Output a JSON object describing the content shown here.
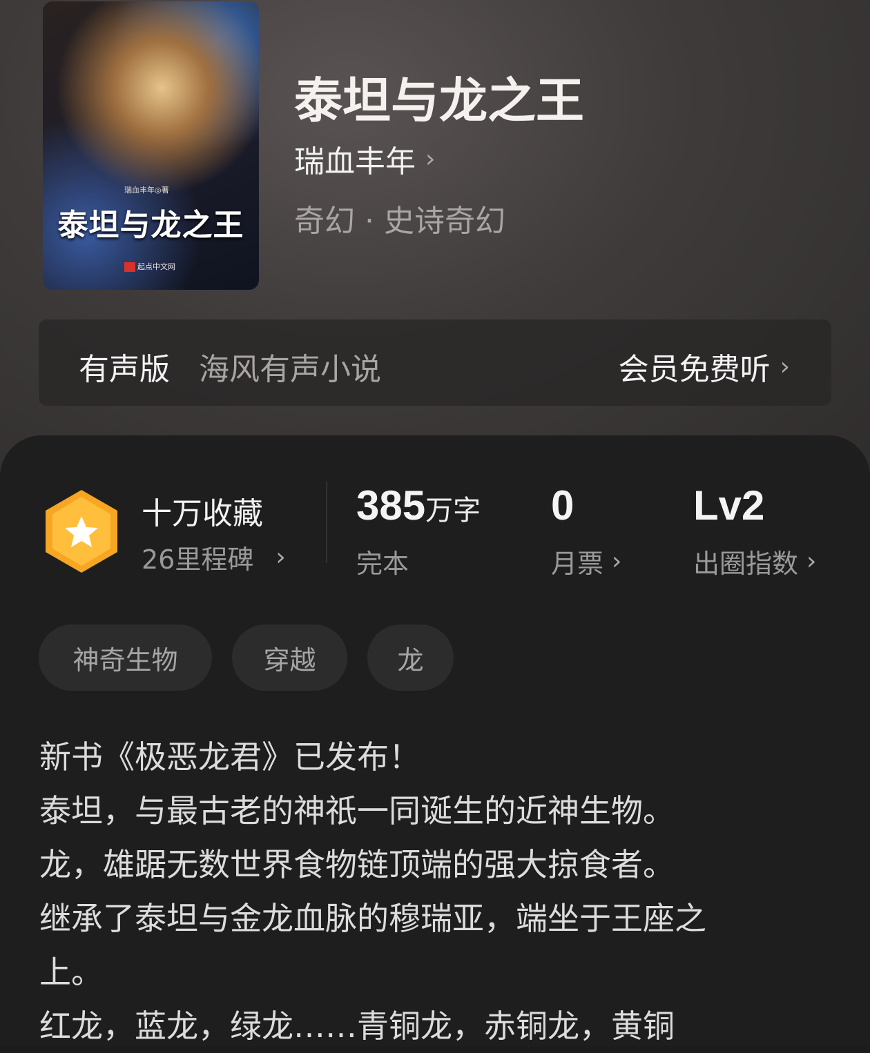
{
  "book": {
    "title": "泰坦与龙之王",
    "author": "瑞血丰年",
    "genre": "奇幻 · 史诗奇幻",
    "cover": {
      "author_text": "瑞血丰年◎著",
      "title_text": "泰坦与龙之王",
      "publisher_text": "起点中文网"
    }
  },
  "audio": {
    "label": "有声版",
    "source": "海风有声小说",
    "cta": "会员免费听"
  },
  "stats": {
    "milestone": {
      "title": "十万收藏",
      "sub": "26里程碑"
    },
    "words": {
      "value": "385",
      "unit": "万字",
      "status": "完本"
    },
    "monthly_ticket": {
      "value": "0",
      "label": "月票"
    },
    "index": {
      "value": "Lv2",
      "label": "出圈指数"
    }
  },
  "tags": [
    "神奇生物",
    "穿越",
    "龙"
  ],
  "description": [
    "新书《极恶龙君》已发布！",
    "泰坦，与最古老的神祇一同诞生的近神生物。",
    "龙，雄踞无数世界食物链顶端的强大掠食者。",
    "继承了泰坦与金龙血脉的穆瑞亚，端坐于王座之",
    "上。",
    "红龙，蓝龙，绿龙……青铜龙，赤铜龙，黄铜"
  ],
  "colors": {
    "badge_outer": "#f6a623",
    "badge_inner": "#ffbf3c",
    "panel_bg": "#1e1e1e"
  },
  "icons": {
    "chevron": "chevron-right-icon",
    "badge": "star-hexagon-icon"
  }
}
